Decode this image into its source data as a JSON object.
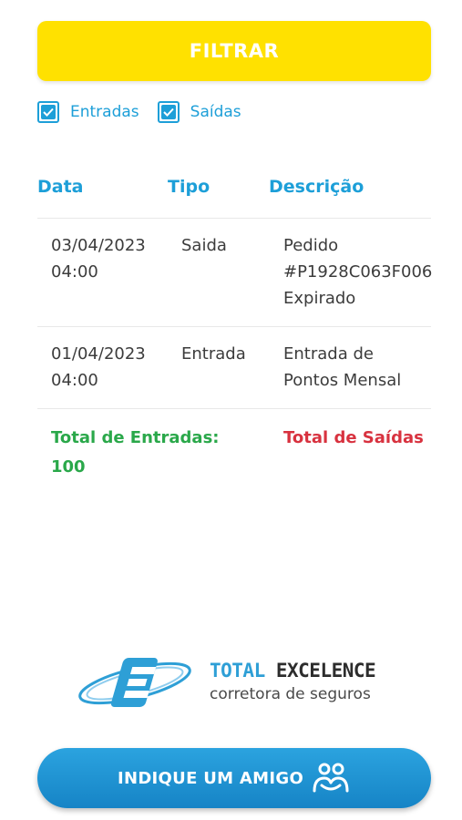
{
  "filter": {
    "label": "FILTRAR"
  },
  "checks": [
    {
      "label": "Entradas",
      "checked": true
    },
    {
      "label": "Saídas",
      "checked": true
    }
  ],
  "table": {
    "headers": [
      "Data",
      "Tipo",
      "Descrição"
    ],
    "rows": [
      {
        "date": "03/04/2023",
        "time": "04:00",
        "type": "Saida",
        "desc": [
          "Pedido",
          "#P1928C063F006",
          "Expirado"
        ]
      },
      {
        "date": "01/04/2023",
        "time": "04:00",
        "type": "Entrada",
        "desc": [
          "Entrada de",
          "Pontos Mensal"
        ]
      }
    ]
  },
  "totals": {
    "in_label": "Total de Entradas:",
    "in_value": "100",
    "out_label": "Total de Saídas"
  },
  "logo": {
    "title_accent": "TOTAL",
    "title_rest": "EXCELENCE",
    "subtitle": "corretora de seguros"
  },
  "indique": {
    "label": "INDIQUE UM AMIGO",
    "icon": "people-icon"
  },
  "colors": {
    "filter_bg": "#ffe100",
    "accent_blue": "#1d9fd8",
    "total_in": "#2aa84a",
    "total_out": "#d8323f"
  }
}
